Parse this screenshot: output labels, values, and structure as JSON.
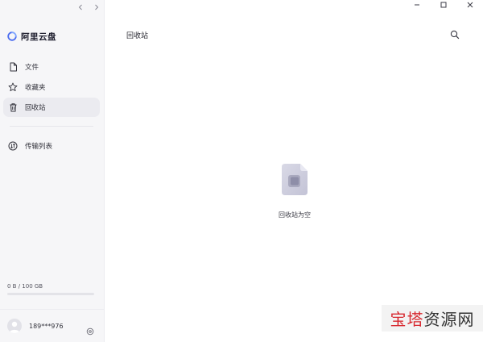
{
  "sidebar": {
    "logo_text": "阿里云盘",
    "items": [
      {
        "label": "文件",
        "icon": "file-icon"
      },
      {
        "label": "收藏夹",
        "icon": "star-icon"
      },
      {
        "label": "回收站",
        "icon": "trash-icon",
        "active": true
      },
      {
        "label": "传输列表",
        "icon": "transfer-icon"
      }
    ],
    "storage": {
      "text": "0 B / 100 GB",
      "used_fraction": 0.0
    },
    "user": {
      "name": "189***976"
    }
  },
  "main": {
    "title": "回收站",
    "empty_text": "回收站为空"
  },
  "watermark": {
    "red": "宝塔",
    "grey": "资源网"
  },
  "colors": {
    "accent": "#6a6af4",
    "sidebar_bg": "#f6f6f8",
    "active_bg": "#ebebf0",
    "watermark_red": "#d7262d"
  }
}
